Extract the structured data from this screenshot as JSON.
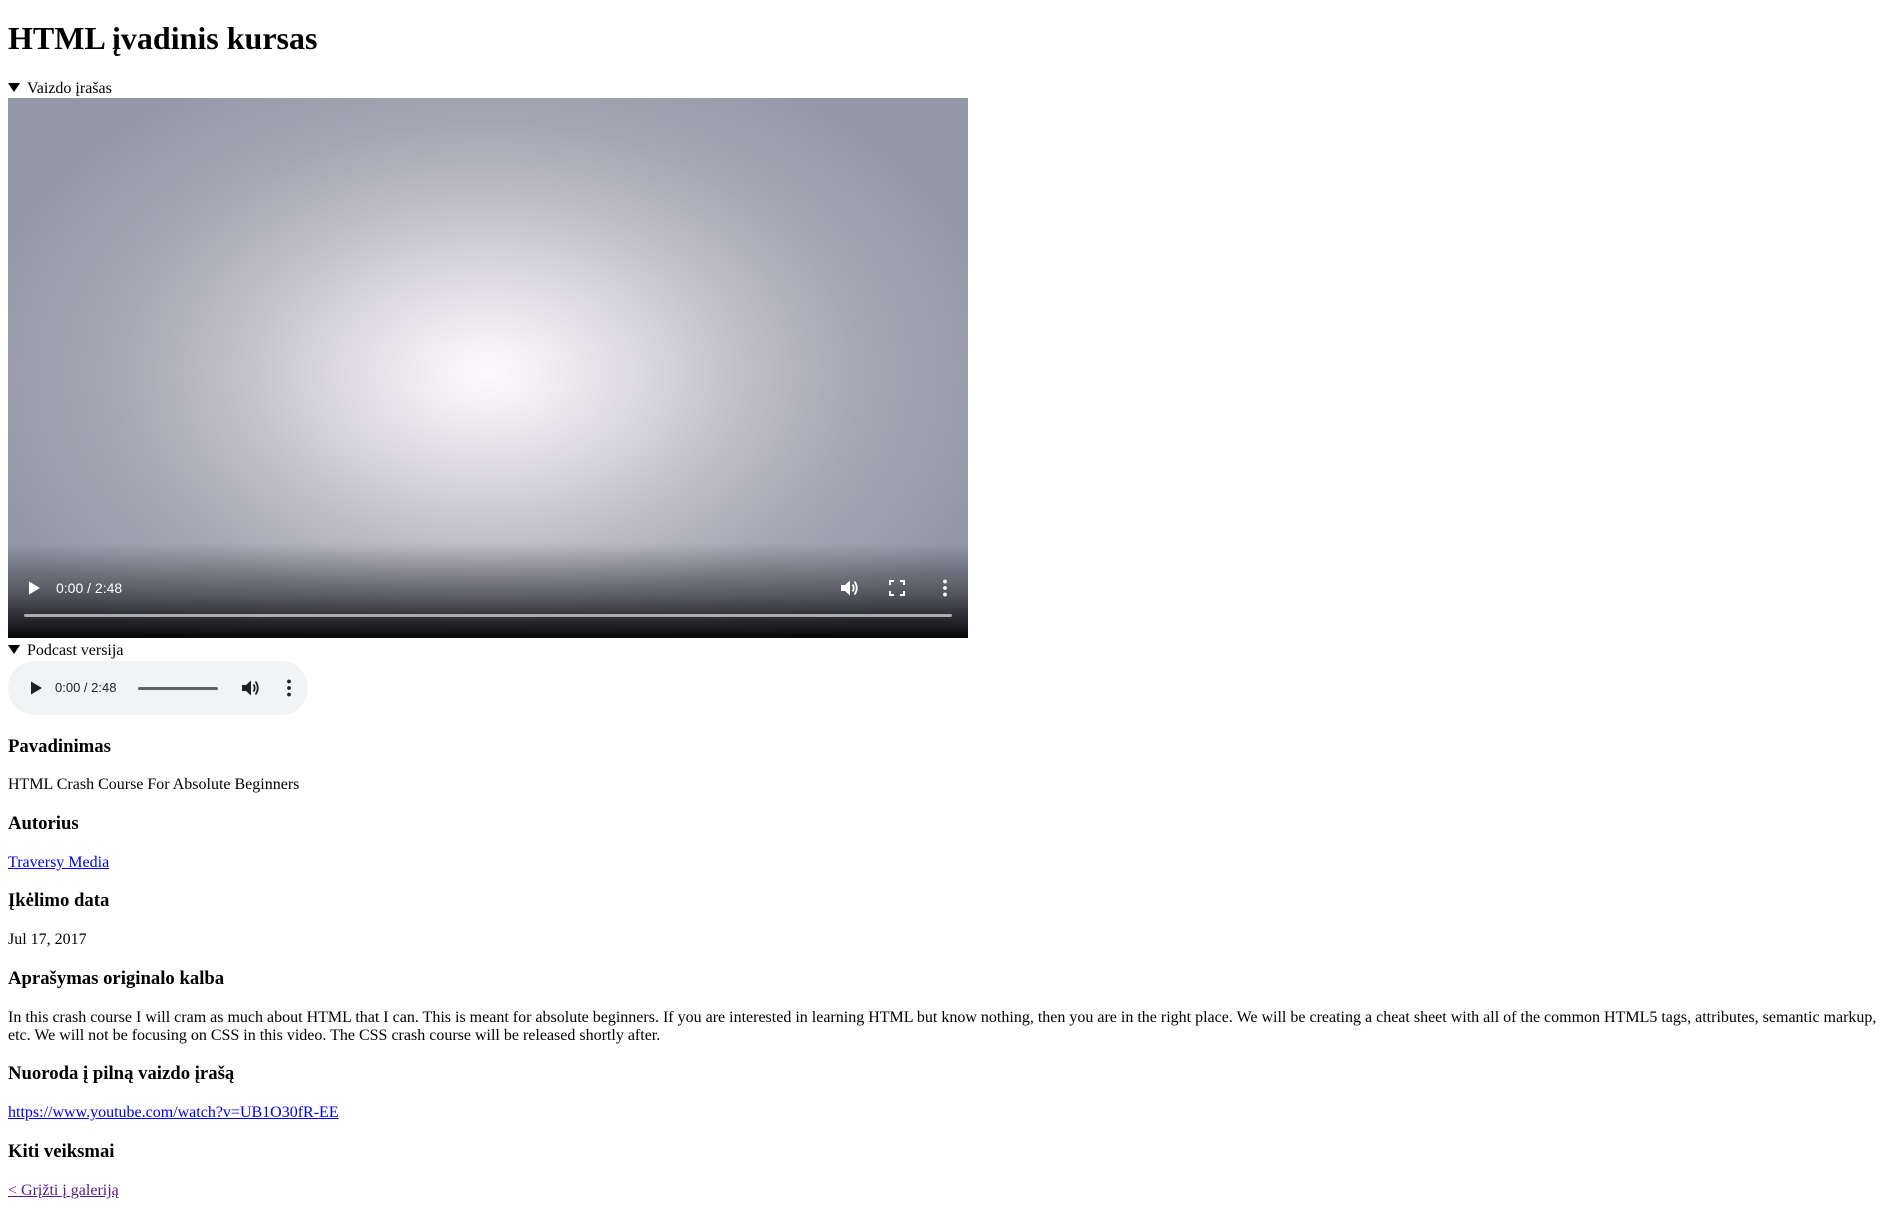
{
  "page": {
    "title": "HTML įvadinis kursas"
  },
  "video_section": {
    "summary": "Vaizdo įrašas",
    "player": {
      "time": "0:00 / 2:48",
      "play_icon": "play-icon",
      "volume_icon": "volume-icon",
      "fullscreen_icon": "fullscreen-icon",
      "more_icon": "more-vertical-icon",
      "progress": 0
    }
  },
  "podcast_section": {
    "summary": "Podcast versija",
    "player": {
      "time": "0:00 / 2:48",
      "play_icon": "play-icon",
      "volume_icon": "volume-icon",
      "more_icon": "more-vertical-icon",
      "progress": 0
    }
  },
  "details": {
    "name_heading": "Pavadinimas",
    "name_value": "HTML Crash Course For Absolute Beginners",
    "author_heading": "Autorius",
    "author_value": "Traversy Media",
    "upload_heading": "Įkėlimo data",
    "upload_value": "Jul 17, 2017",
    "description_heading": "Aprašymas originalo kalba",
    "description_value": "In this crash course I will cram as much about HTML that I can. This is meant for absolute beginners. If you are interested in learning HTML but know nothing, then you are in the right place. We will be creating a cheat sheet with all of the common HTML5 tags, attributes, semantic markup, etc. We will not be focusing on CSS in this video. The CSS crash course will be released shortly after.",
    "link_heading": "Nuoroda į pilną vaizdo įrašą",
    "link_value": "https://www.youtube.com/watch?v=UB1O30fR-EE",
    "actions_heading": "Kiti veiksmai",
    "back_link": "< Grįžti į galeriją"
  }
}
